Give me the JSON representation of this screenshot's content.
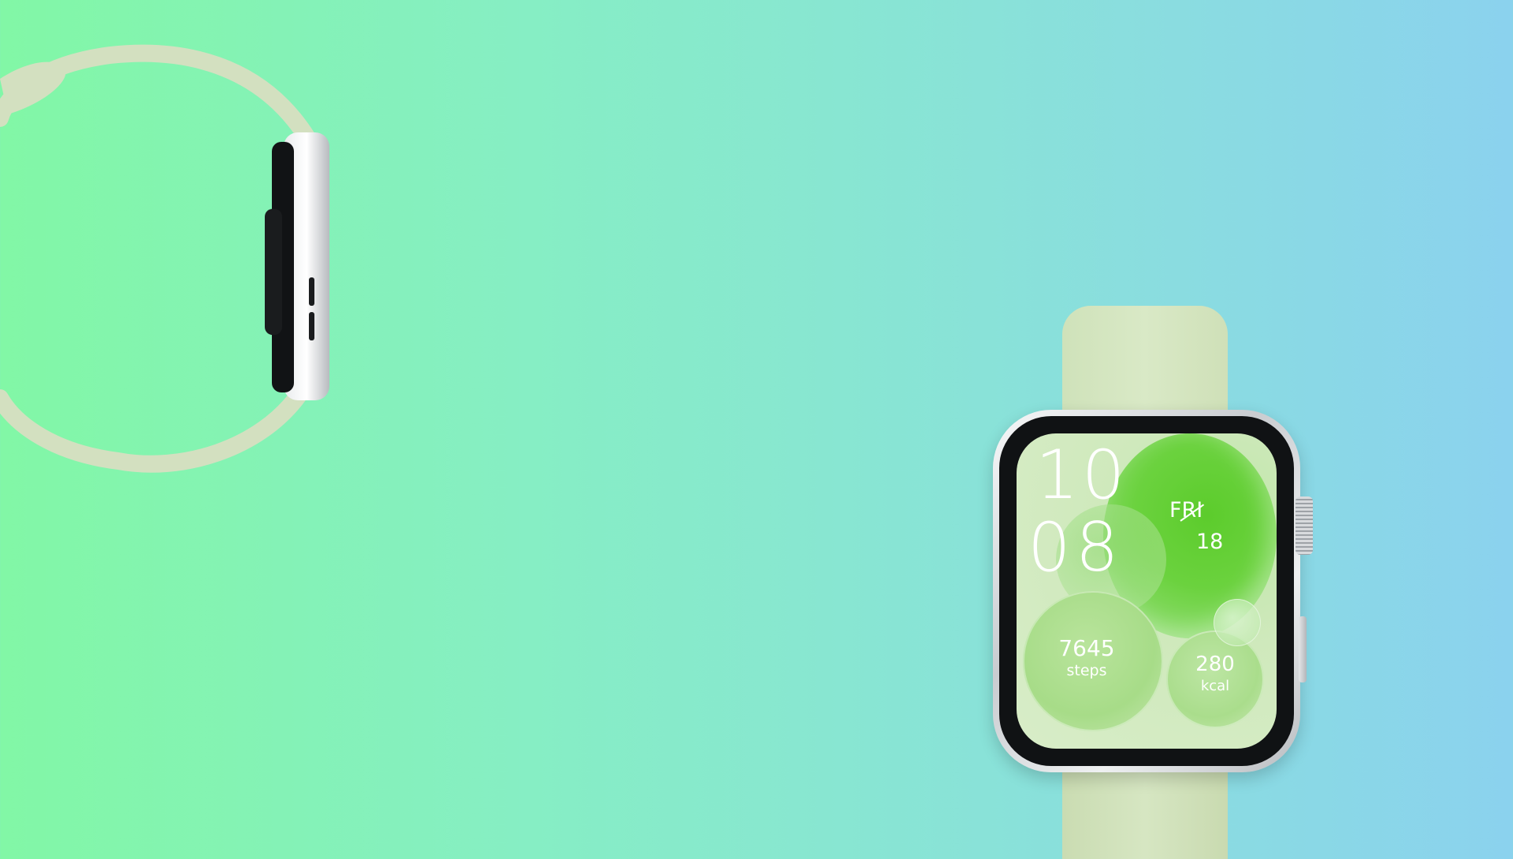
{
  "colors": {
    "background_left": "#82f7a6",
    "background_right": "#8bd2ee",
    "band": "#d3e4bf",
    "case": "#d9dcdf",
    "face_accent": "#5ccc2c"
  },
  "watch_face": {
    "hour": "10",
    "minute": "08",
    "day": "FRI",
    "date": "18",
    "steps_value": "7645",
    "steps_label": "steps",
    "kcal_value": "280",
    "kcal_label": "kcal"
  },
  "icons": [
    "side-view-watch",
    "front-view-watch"
  ]
}
